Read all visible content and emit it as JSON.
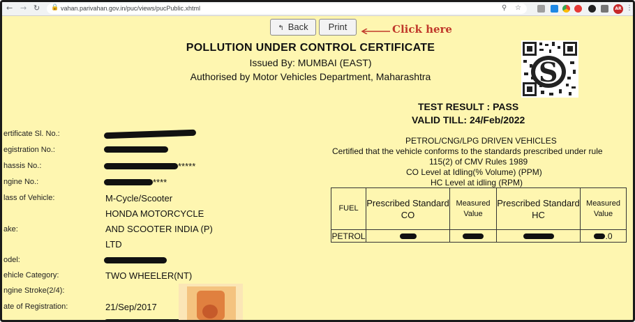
{
  "browser": {
    "back_icon": "arrow-left-icon",
    "forward_icon": "arrow-right-icon",
    "reload_icon": "reload-icon",
    "url": "vahan.parivahan.gov.in/puc/views/pucPublic.xhtml",
    "avatar_label": "AR"
  },
  "actions": {
    "back_label": "Back",
    "print_label": "Print",
    "annotation": "Click here"
  },
  "header": {
    "title": "POLLUTION UNDER CONTROL CERTIFICATE",
    "issued_by": "Issued By: MUMBAI (EAST)",
    "authorised_by": "Authorised by Motor Vehicles Department, Maharashtra"
  },
  "result": {
    "test_result": "TEST RESULT : PASS",
    "valid_till": "VALID TILL: 24/Feb/2022"
  },
  "certification": {
    "vehicle_type": "PETROL/CNG/LPG DRIVEN VEHICLES",
    "line1": "Certified that the vehicle conforms to the standards prescribed under rule",
    "line2": "115(2) of CMV Rules 1989",
    "co_level": "CO Level at Idling(% Volume) (PPM)",
    "hc_level": "HC Level at idling (RPM)"
  },
  "fields": [
    {
      "label": "ertificate Sl. No.:",
      "value": ""
    },
    {
      "label": "egistration No.:",
      "value": ""
    },
    {
      "label": "hassis No.:",
      "value": "*****"
    },
    {
      "label": "ngine No.:",
      "value": "****"
    },
    {
      "label": "lass of Vehicle:",
      "value": "M-Cycle/Scooter"
    },
    {
      "label": "",
      "value": "HONDA MOTORCYCLE"
    },
    {
      "label": "ake:",
      "value": "AND SCOOTER INDIA (P)"
    },
    {
      "label": "",
      "value": "LTD"
    },
    {
      "label": "odel:",
      "value": ""
    },
    {
      "label": "ehicle Category:",
      "value": "TWO WHEELER(NT)"
    },
    {
      "label": "ngine Stroke(2/4):",
      "value": ""
    },
    {
      "label": "ate of Registration:",
      "value": "21/Sep/2017"
    }
  ],
  "fuel_table": {
    "headers": [
      "FUEL",
      "Prescribed Standard CO",
      "Measured Value",
      "Prescribed Standard HC",
      "Measured Value"
    ],
    "fuel": "PETROL",
    "hc_measured_suffix": ".0"
  }
}
